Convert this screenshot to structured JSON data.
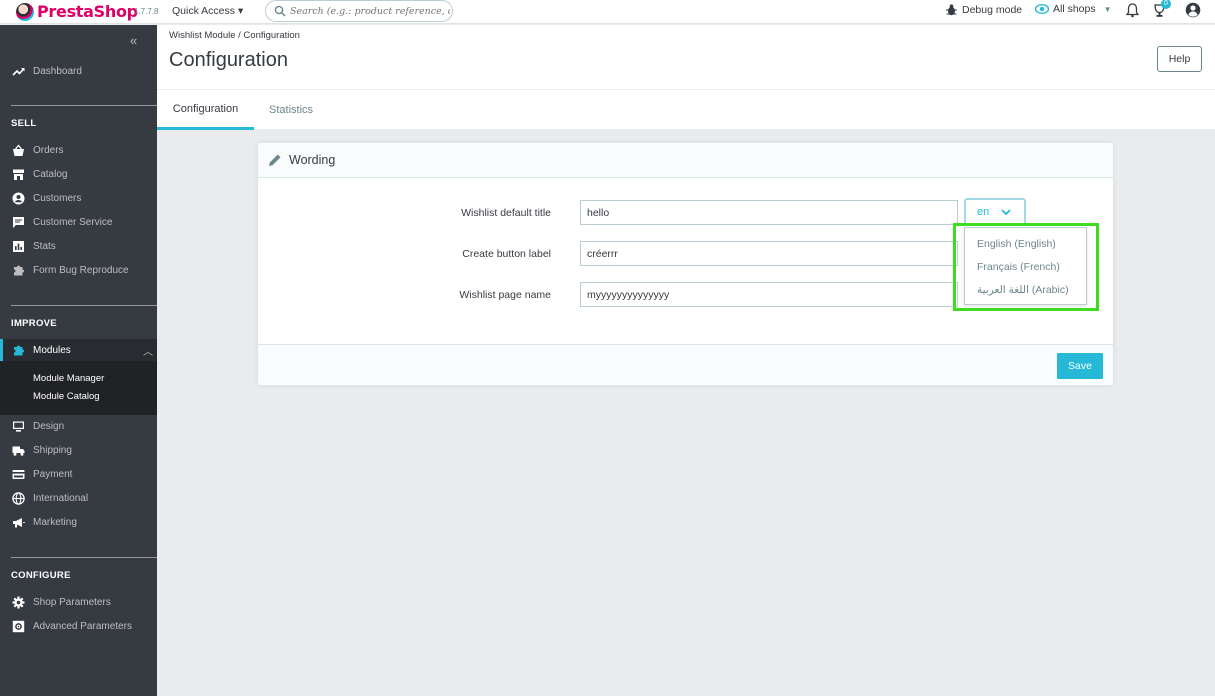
{
  "header": {
    "brand": "PrestaShop",
    "version": "1.7.7.8",
    "quick_access": "Quick Access ▾",
    "search_placeholder": "Search (e.g.: product reference, customer name...)",
    "debug_mode": "Debug mode",
    "all_shops": "All shops",
    "notifications_badge": "0"
  },
  "sidebar": {
    "dashboard": "Dashboard",
    "sell_section": "SELL",
    "sell_items": [
      "Orders",
      "Catalog",
      "Customers",
      "Customer Service",
      "Stats",
      "Form Bug Reproduce"
    ],
    "improve_section": "IMPROVE",
    "modules": "Modules",
    "modules_sub": [
      "Module Manager",
      "Module Catalog"
    ],
    "improve_items": [
      "Design",
      "Shipping",
      "Payment",
      "International",
      "Marketing"
    ],
    "configure_section": "CONFIGURE",
    "configure_items": [
      "Shop Parameters",
      "Advanced Parameters"
    ]
  },
  "page": {
    "breadcrumb": "Wishlist Module  /  Configuration",
    "title": "Configuration",
    "help": "Help",
    "tabs": [
      "Configuration",
      "Statistics"
    ]
  },
  "panel": {
    "title": "Wording",
    "fields": [
      {
        "label": "Wishlist default title",
        "value": "hello"
      },
      {
        "label": "Create button label",
        "value": "créerrr"
      },
      {
        "label": "Wishlist page name",
        "value": "myyyyyyyyyyyyyy"
      }
    ],
    "language": "en",
    "save": "Save"
  },
  "dropdown": {
    "options": [
      "English (English)",
      "Français (French)",
      "اللغة العربية (Arabic)"
    ]
  },
  "colors": {
    "accent": "#25b9d7",
    "sidebar": "#363a41",
    "highlight": "#3ddc1e",
    "brand": "#df0067"
  }
}
